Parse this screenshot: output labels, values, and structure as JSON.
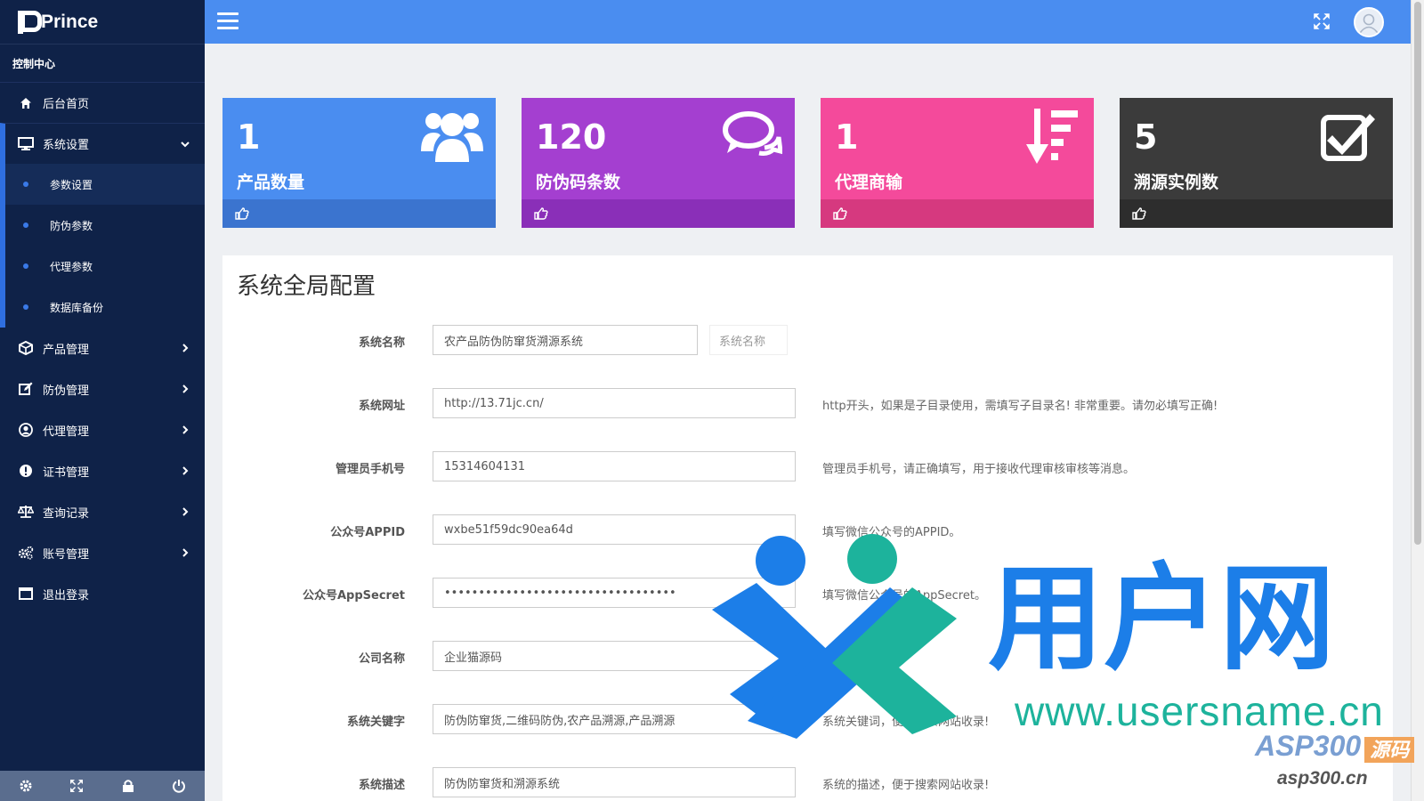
{
  "brand": {
    "name": "Prince"
  },
  "sidebar": {
    "section": "控制中心",
    "items": [
      {
        "label": "后台首页",
        "icon": "home-icon"
      },
      {
        "label": "系统设置",
        "icon": "monitor-icon",
        "open": true,
        "children": [
          {
            "label": "参数设置",
            "active": true
          },
          {
            "label": "防伪参数"
          },
          {
            "label": "代理参数"
          },
          {
            "label": "数据库备份"
          }
        ]
      },
      {
        "label": "产品管理",
        "icon": "cube-icon"
      },
      {
        "label": "防伪管理",
        "icon": "edit-icon"
      },
      {
        "label": "代理管理",
        "icon": "user-circle-icon"
      },
      {
        "label": "证书管理",
        "icon": "alert-icon"
      },
      {
        "label": "查询记录",
        "icon": "scale-icon"
      },
      {
        "label": "账号管理",
        "icon": "cogs-icon"
      },
      {
        "label": "退出登录",
        "icon": "window-icon"
      }
    ]
  },
  "cards": [
    {
      "value": "1",
      "label": "产品数量",
      "color": "#4a8df0",
      "foot_color": "#3b74cf",
      "icon": "users-icon"
    },
    {
      "value": "120",
      "label": "防伪码条数",
      "color": "#a43fd0",
      "foot_color": "#8a2fb8",
      "icon": "comments-icon"
    },
    {
      "value": "1",
      "label": "代理商输",
      "color": "#f44a9b",
      "foot_color": "#d6397f",
      "icon": "sort-desc-icon"
    },
    {
      "value": "5",
      "label": "溯源实例数",
      "color": "#3b3b3b",
      "foot_color": "#2d2d2d",
      "icon": "check-square-icon"
    }
  ],
  "panel": {
    "title": "系统全局配置",
    "fields": [
      {
        "label": "系统名称",
        "value": "农产品防伪防窜货溯源系统",
        "addon": "系统名称",
        "help": ""
      },
      {
        "label": "系统网址",
        "value": "http://13.71jc.cn/",
        "help": "http开头，如果是子目录使用，需填写子目录名! 非常重要。请勿必填写正确!"
      },
      {
        "label": "管理员手机号",
        "value": "15314604131",
        "help": "管理员手机号，请正确填写，用于接收代理审核审核等消息。"
      },
      {
        "label": "公众号APPID",
        "value": "wxbe51f59dc90ea64d",
        "help": "填写微信公众号的APPID。"
      },
      {
        "label": "公众号AppSecret",
        "value": "••••••••••••••••••••••••••••••••••",
        "help": "填写微信公众号的AppSecret。"
      },
      {
        "label": "公司名称",
        "value": "企业猫源码",
        "help": "公司名称。"
      },
      {
        "label": "系统关键字",
        "value": "防伪防窜货,二维码防伪,农产品溯源,产品溯源",
        "help": "系统关键词，便于搜索网站收录!"
      },
      {
        "label": "系统描述",
        "value": "防伪防窜货和溯源系统",
        "help": "系统的描述，便于搜索网站收录!"
      }
    ]
  },
  "watermark": {
    "logo_text": "用户网",
    "url": "www.usersname.cn",
    "asp": "ASP300",
    "asp_tag": "源码",
    "asp_url": "asp300.cn"
  }
}
